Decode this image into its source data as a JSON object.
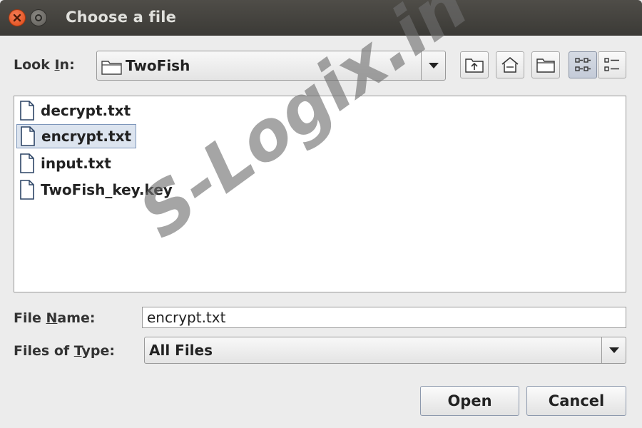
{
  "window": {
    "title": "Choose a file"
  },
  "look_in": {
    "label_pre": "Look ",
    "label_mnemonic": "I",
    "label_post": "n:",
    "folder": "TwoFish"
  },
  "toolbar": {
    "icons": [
      "up-one-level-icon",
      "home-icon",
      "new-folder-icon",
      "list-view-icon",
      "details-view-icon"
    ]
  },
  "files": [
    {
      "name": "decrypt.txt",
      "selected": false
    },
    {
      "name": "encrypt.txt",
      "selected": true
    },
    {
      "name": "input.txt",
      "selected": false
    },
    {
      "name": "TwoFish_key.key",
      "selected": false
    }
  ],
  "file_name": {
    "label_pre": "File ",
    "label_mnemonic": "N",
    "label_post": "ame:",
    "value": "encrypt.txt"
  },
  "file_type": {
    "label_pre": "Files of ",
    "label_mnemonic": "T",
    "label_post": "ype:",
    "value": "All Files"
  },
  "buttons": {
    "open": "Open",
    "cancel": "Cancel"
  },
  "watermark": "S-Logix.in",
  "colors": {
    "titlebar": "#3b3a36",
    "close": "#df4a16",
    "selection": "#dce4ef"
  }
}
